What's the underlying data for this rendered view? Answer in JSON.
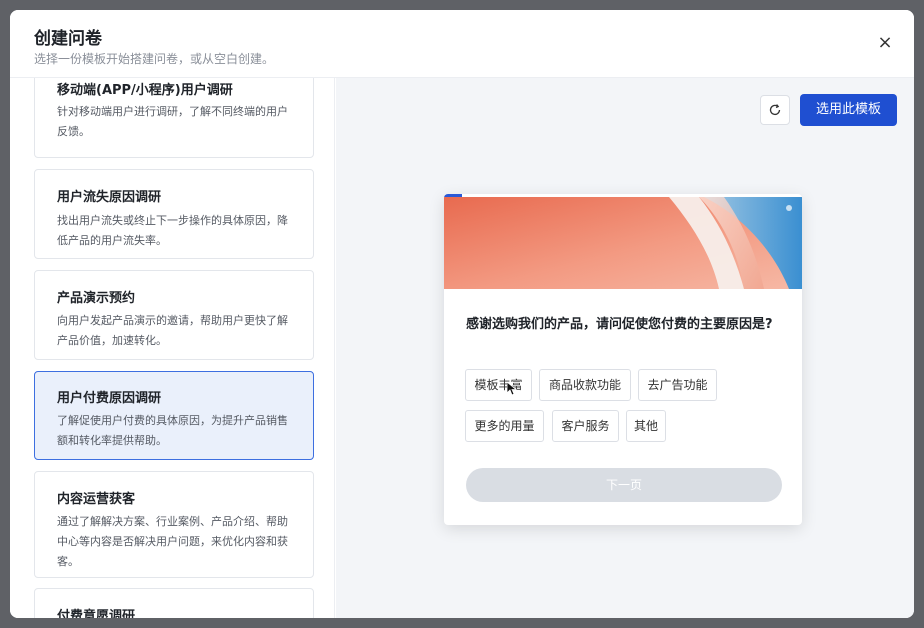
{
  "header": {
    "title": "创建问卷",
    "subtitle": "选择一份模板开始搭建问卷，或从空白创建。",
    "close_glyph": "×"
  },
  "templates": [
    {
      "title": "移动端(APP/小程序)用户调研",
      "desc": "针对移动端用户进行调研，了解不同终端的用户反馈。"
    },
    {
      "title": "用户流失原因调研",
      "desc": "找出用户流失或终止下一步操作的具体原因，降低产品的用户流失率。"
    },
    {
      "title": "产品演示预约",
      "desc": "向用户发起产品演示的邀请，帮助用户更快了解产品价值，加速转化。"
    },
    {
      "title": "用户付费原因调研",
      "desc": "了解促使用户付费的具体原因，为提升产品销售额和转化率提供帮助。"
    },
    {
      "title": "内容运营获客",
      "desc": "通过了解解决方案、行业案例、产品介绍、帮助中心等内容是否解决用户问题，来优化内容和获客。"
    },
    {
      "title": "付费意愿调研",
      "desc": ""
    }
  ],
  "selected_template": "用户付费原因调研",
  "toolbar": {
    "use_template_label": "选用此模板"
  },
  "survey": {
    "question": "感谢选购我们的产品，请问促使您付费的主要原因是?",
    "options": [
      "模板丰富",
      "商品收款功能",
      "去广告功能",
      "更多的用量",
      "客户服务",
      "其他"
    ],
    "next_label": "下一页"
  },
  "colors": {
    "accent": "#1f4fd1",
    "selected_bg": "#eaf0fb",
    "selected_border": "#3d6fe0"
  }
}
